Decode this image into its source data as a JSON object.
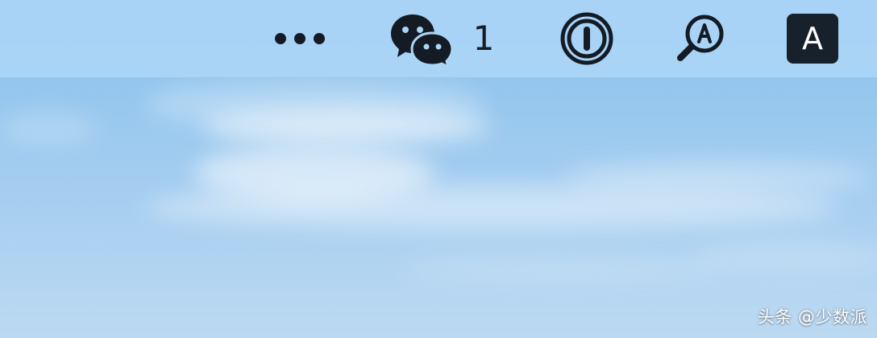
{
  "menubar": {
    "items": [
      {
        "icon": "more-icon"
      },
      {
        "icon": "wechat-icon",
        "label": "1"
      },
      {
        "icon": "onepassword-icon"
      },
      {
        "icon": "dictionary-lookup-icon"
      },
      {
        "icon": "input-source-icon",
        "label": "A"
      }
    ]
  },
  "watermark": {
    "text": "头条 @少数派"
  },
  "colors": {
    "icon": "#141b24",
    "menubar_background": "#aad5f6",
    "sky_top": "#8ec0ea",
    "sky_bottom": "#bcd9f1"
  }
}
